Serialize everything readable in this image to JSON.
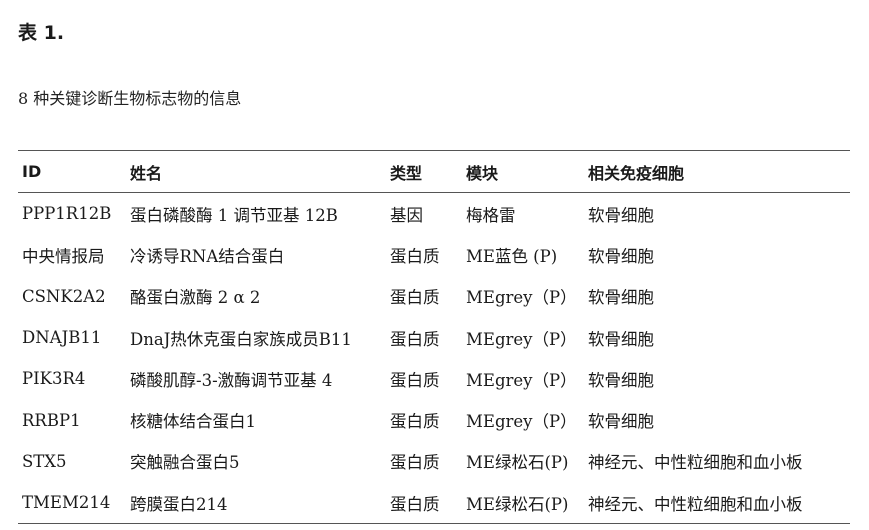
{
  "title": "表 1.",
  "caption": "8 种关键诊断生物标志物的信息",
  "table": {
    "headers": [
      "ID",
      "姓名",
      "类型",
      "模块",
      "相关免疫细胞"
    ],
    "rows": [
      [
        "PPP1R12B",
        "蛋白磷酸酶 1 调节亚基 12B",
        "基因",
        "梅格雷",
        "软骨细胞"
      ],
      [
        "中央情报局",
        "冷诱导RNA结合蛋白",
        "蛋白质",
        "ME蓝色 (P)",
        "软骨细胞"
      ],
      [
        "CSNK2A2",
        "酪蛋白激酶 2 α 2",
        "蛋白质",
        "MEgrey（P）",
        "软骨细胞"
      ],
      [
        "DNAJB11",
        "DnaJ热休克蛋白家族成员B11",
        "蛋白质",
        "MEgrey（P）",
        "软骨细胞"
      ],
      [
        "PIK3R4",
        "磷酸肌醇-3-激酶调节亚基 4",
        "蛋白质",
        "MEgrey（P）",
        "软骨细胞"
      ],
      [
        "RRBP1",
        "核糖体结合蛋白1",
        "蛋白质",
        "MEgrey（P）",
        "软骨细胞"
      ],
      [
        "STX5",
        "突触融合蛋白5",
        "蛋白质",
        "ME绿松石(P)",
        "神经元、中性粒细胞和血小板"
      ],
      [
        "TMEM214",
        "跨膜蛋白214",
        "蛋白质",
        "ME绿松石(P)",
        "神经元、中性粒细胞和血小板"
      ]
    ]
  }
}
